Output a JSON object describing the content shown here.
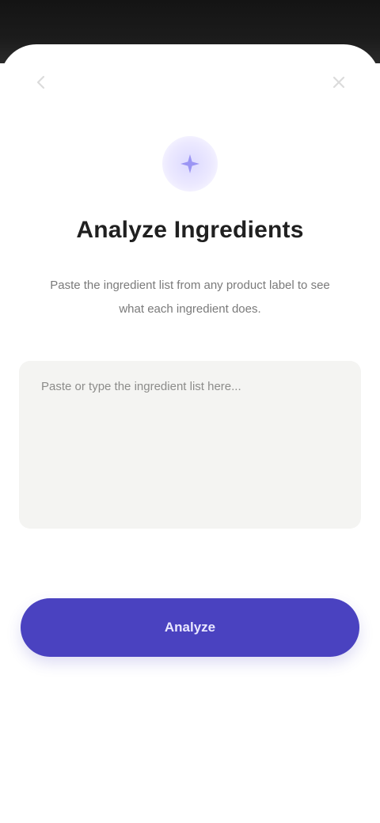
{
  "header": {
    "title": "Analyze Ingredients",
    "subtitle": "Paste the ingredient list from any product label to see what each ingredient does."
  },
  "input": {
    "placeholder": "Paste or type the ingredient list here...",
    "value": ""
  },
  "actions": {
    "primary_label": "Analyze"
  },
  "icons": {
    "top_left": "back-chevron-icon",
    "top_right": "close-icon",
    "hero": "sparkle-icon"
  },
  "colors": {
    "accent": "#4a42c0",
    "hero_tint": "#dcd9ff",
    "field_background": "#f4f4f2",
    "title": "#202020",
    "subtitle": "#7a7a7a"
  }
}
